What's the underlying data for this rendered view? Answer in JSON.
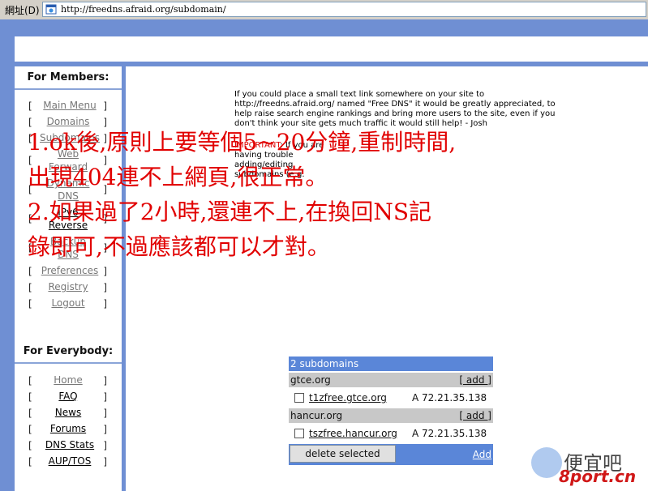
{
  "address_bar": {
    "label": "網址(D)",
    "url": "http://freedns.afraid.org/subdomain/"
  },
  "sidebar": {
    "members_heading": "For Members:",
    "members_items": [
      {
        "label": "Main Menu"
      },
      {
        "label": "Domains"
      },
      {
        "label": "Subdomains"
      },
      {
        "line1": "Web",
        "line2": "Forward"
      },
      {
        "line1": "Dynamic",
        "line2": "DNS"
      },
      {
        "line1": "IPv6",
        "line2": "Reverse"
      },
      {
        "line1": "Backup",
        "line2": "DNS"
      },
      {
        "label": "Preferences"
      },
      {
        "label": "Registry"
      },
      {
        "label": "Logout"
      }
    ],
    "everybody_heading": "For Everybody:",
    "everybody_items": [
      {
        "label": "Home"
      },
      {
        "label": "FAQ"
      },
      {
        "label": "News"
      },
      {
        "label": "Forums"
      },
      {
        "label": "DNS Stats"
      },
      {
        "label": "AUP/TOS"
      }
    ],
    "bracket_left": "[",
    "bracket_right": "]"
  },
  "main": {
    "intro_text": "If you could place a small text link somewhere on your site to http://freedns.afraid.org/ named \"Free DNS\" it would be greatly appreciated, to help raise search engine rankings and bring more users to the site, even if you don't think your site gets much traffic it would still help! - Josh",
    "important_label": "IMPORTANT",
    "important_text": ": If you are having trouble adding/editing subdomains (e.g.",
    "overlay_lines": [
      "1.ok後,原則上要等個5~20分鐘,重制時間,",
      "出現404連不上網頁,很正常。",
      "2.如果過了2小時,還連不上,在換回NS記",
      "錄即可,不過應該都可以才對。"
    ],
    "subdomains": {
      "header": "2 subdomains",
      "groups": [
        {
          "domain": "gtce.org",
          "add_label": "[ add ]",
          "host": "t1zfree.gtce.org",
          "type": "A",
          "ip": "72.21.35.138"
        },
        {
          "domain": "hancur.org",
          "add_label": "[ add ]",
          "host": "tszfree.hancur.org",
          "type": "A",
          "ip": "72.21.35.138"
        }
      ],
      "delete_label": "delete selected",
      "add_link": "Add"
    }
  },
  "watermark": {
    "chinese": "便宜吧",
    "url": "8port.cn"
  }
}
